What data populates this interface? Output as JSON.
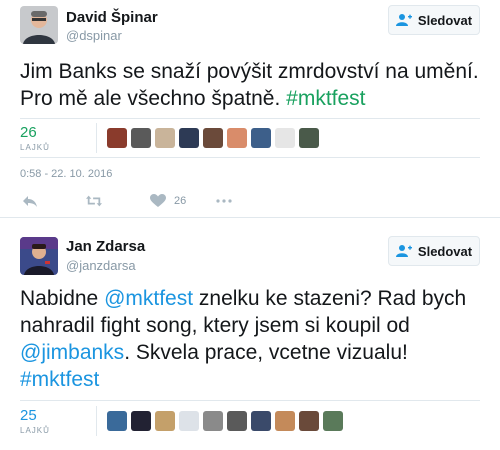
{
  "tweets": [
    {
      "author_name": "David Špinar",
      "author_handle": "@dspinar",
      "follow_label": "Sledovat",
      "text_plain": "Jim Banks se snaží povýšit zmrdovství na umění. Pro mě ale všechno špatně. ",
      "hashtag": "#mktfest",
      "likes_count": "26",
      "likes_label": "LAJKŮ",
      "timestamp": "0:58 - 22. 10. 2016",
      "action_like_count": "26",
      "liker_colors": [
        "#8a3b2c",
        "#5a5a5a",
        "#c9b49a",
        "#2d3a55",
        "#6b4a3a",
        "#d98c6a",
        "#3d5f8a",
        "#e6e6e6",
        "#4a5a4a"
      ]
    },
    {
      "author_name": "Jan Zdarsa",
      "author_handle": "@janzdarsa",
      "follow_label": "Sledovat",
      "text_part1": "Nabidne ",
      "mention1": "@mktfest",
      "text_part2": " znelku ke stazeni? Rad bych nahradil fight song, ktery jsem si koupil od ",
      "mention2": "@jimbanks",
      "text_part3": ". Skvela prace, vcetne vizualu! ",
      "hashtag": "#mktfest",
      "likes_count": "25",
      "likes_label": "LAJKŮ",
      "liker_colors": [
        "#3a6a9a",
        "#222233",
        "#c4a06a",
        "#dde2e8",
        "#8a8a8a",
        "#5a5a5a",
        "#3a4a6a",
        "#c48a5a",
        "#6a4a3a",
        "#5a7a5a"
      ]
    }
  ],
  "colors": {
    "accent_blue": "#1b95e0",
    "accent_green": "#19a15f",
    "muted": "#8899a6",
    "border": "#e1e8ed"
  },
  "icons": {
    "follow": "add-user-icon",
    "reply": "reply-icon",
    "retweet": "retweet-icon",
    "like": "heart-icon",
    "more": "more-dots-icon"
  }
}
